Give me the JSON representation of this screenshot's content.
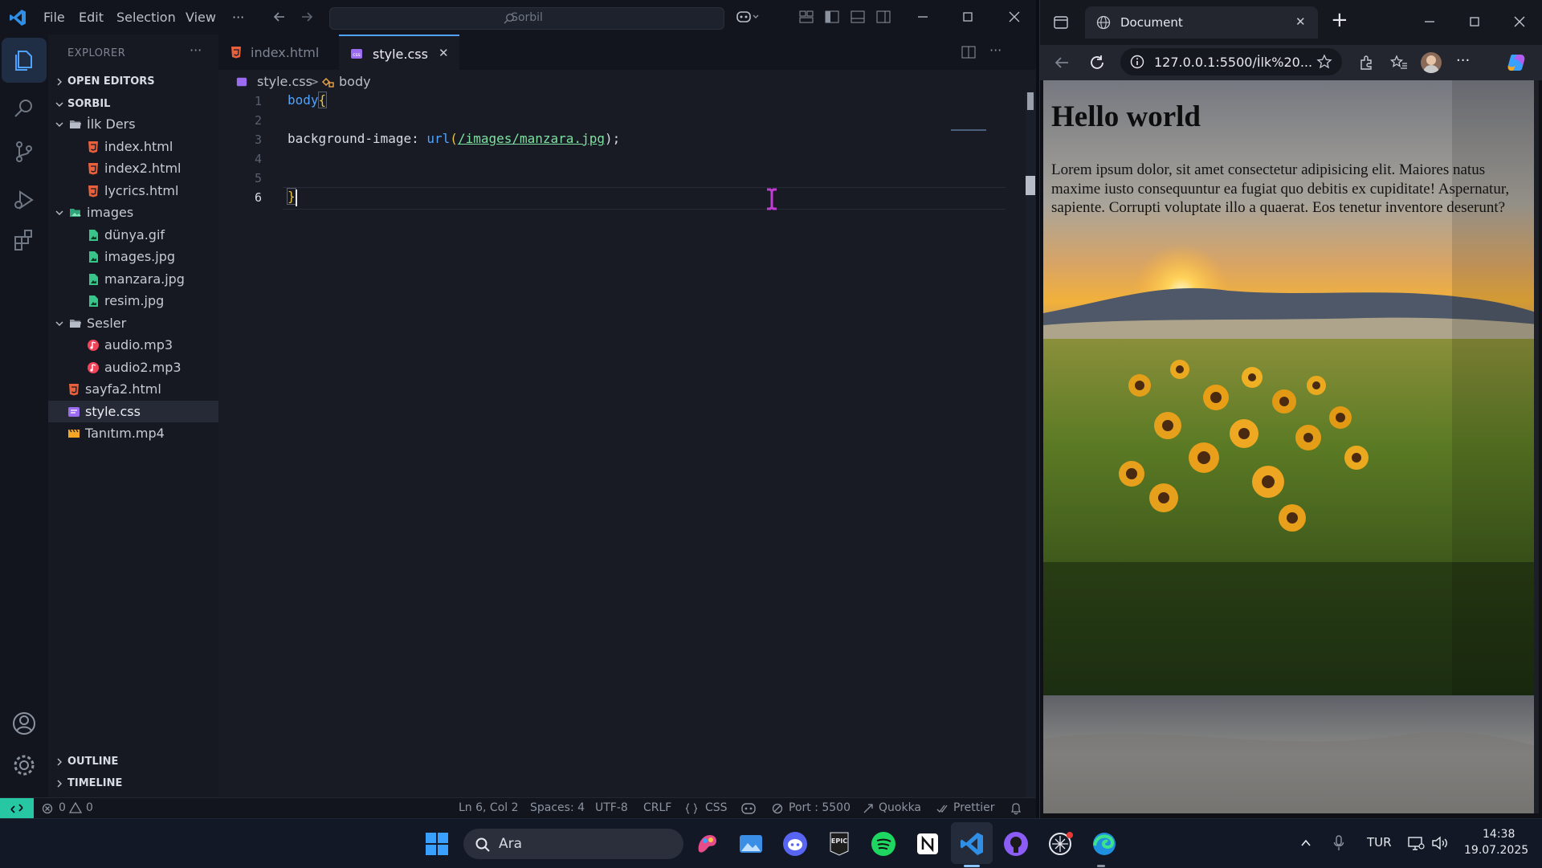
{
  "vscode": {
    "menu": [
      "File",
      "Edit",
      "Selection",
      "View"
    ],
    "more": "···",
    "command_center": "Sorbil",
    "sidebar": {
      "title": "EXPLORER",
      "more": "···",
      "open_editors": "OPEN EDITORS",
      "workspace": "SORBIL",
      "tree": [
        {
          "label": "İlk Ders",
          "type": "folder-open",
          "indent": 1
        },
        {
          "label": "index.html",
          "type": "html",
          "indent": 2
        },
        {
          "label": "index2.html",
          "type": "html",
          "indent": 2
        },
        {
          "label": "lycrics.html",
          "type": "html",
          "indent": 2
        },
        {
          "label": "images",
          "type": "folder-images",
          "indent": 1
        },
        {
          "label": "dünya.gif",
          "type": "image",
          "indent": 2
        },
        {
          "label": "images.jpg",
          "type": "image",
          "indent": 2
        },
        {
          "label": "manzara.jpg",
          "type": "image",
          "indent": 2
        },
        {
          "label": "resim.jpg",
          "type": "image",
          "indent": 2
        },
        {
          "label": "Sesler",
          "type": "folder-open",
          "indent": 1
        },
        {
          "label": "audio.mp3",
          "type": "audio",
          "indent": 2
        },
        {
          "label": "audio2.mp3",
          "type": "audio",
          "indent": 2
        },
        {
          "label": "sayfa2.html",
          "type": "html",
          "indent": 1
        },
        {
          "label": "style.css",
          "type": "css",
          "indent": 1,
          "selected": true
        },
        {
          "label": "Tanıtım.mp4",
          "type": "video",
          "indent": 1
        }
      ],
      "outline": "OUTLINE",
      "timeline": "TIMELINE"
    },
    "tabs": [
      {
        "label": "index.html",
        "active": false
      },
      {
        "label": "style.css",
        "active": true
      }
    ],
    "tab_close": "✕",
    "breadcrumb": {
      "file": "style.css",
      "sep": ">",
      "symbol": "body"
    },
    "code": {
      "line_numbers": [
        "1",
        "2",
        "3",
        "4",
        "5",
        "6"
      ],
      "line1_selector": "body",
      "line1_brace": "{",
      "line3_prop": "background-image: ",
      "line3_func": "url",
      "line3_open": "(",
      "line3_arg": "/images/manzara.jpg",
      "line3_close": ");",
      "line6_brace": "}"
    },
    "status": {
      "problems": "0",
      "warnings": "0",
      "position": "Ln 6, Col 2",
      "spaces": "Spaces: 4",
      "encoding": "UTF-8",
      "eol": "CRLF",
      "language": "CSS",
      "port": "Port : 5500",
      "quokka": "Quokka",
      "prettier": "Prettier"
    }
  },
  "browser": {
    "tab_title": "Document",
    "tab_close": "✕",
    "new_tab": "+",
    "url": "127.0.0.1:5500/İlk%20...",
    "page": {
      "heading": "Hello world",
      "paragraph": "Lorem ipsum dolor, sit amet consectetur adipisicing elit. Maiores natus maxime iusto consequuntur ea fugiat quo debitis ex cupiditate! Aspernatur, sapiente. Corrupti voluptate illo a quaerat. Eos tenetur inventore deserunt?"
    }
  },
  "taskbar": {
    "search_placeholder": "Ara",
    "language": "TUR",
    "time": "14:38",
    "date": "19.07.2025"
  },
  "colors": {
    "accent_blue": "#4fa3ff",
    "html_icon": "#e8603c",
    "css_icon": "#9b6cf0",
    "image_icon": "#38c58a",
    "audio_icon": "#f0445a",
    "remote_green": "#27c7a4"
  }
}
